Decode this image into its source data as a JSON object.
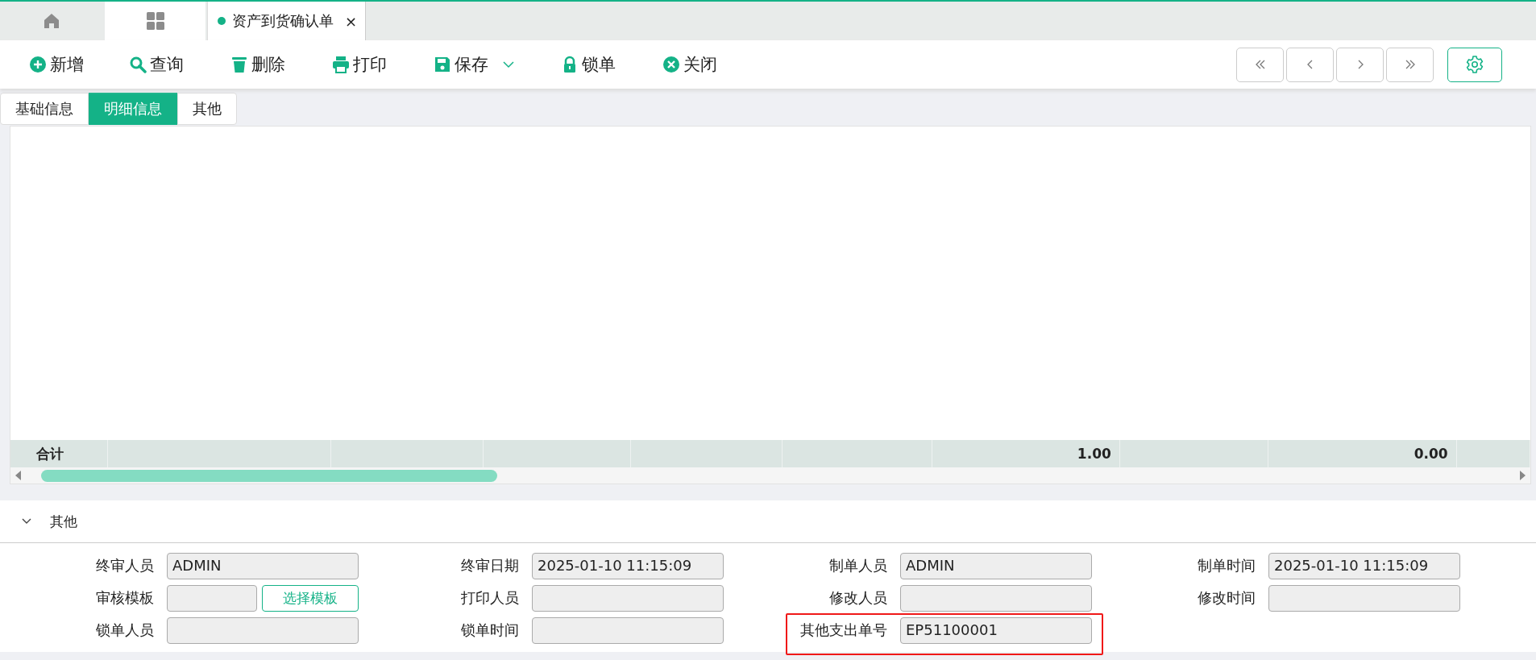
{
  "tabs": [
    {
      "kind": "home",
      "selected": false
    },
    {
      "kind": "grid",
      "selected": true
    },
    {
      "kind": "document",
      "label": "资产到货确认单",
      "close": "×",
      "selected": true
    }
  ],
  "toolbar": [
    {
      "kind": "add",
      "label": "新增"
    },
    {
      "kind": "search",
      "label": "查询"
    },
    {
      "kind": "delete",
      "label": "删除"
    },
    {
      "kind": "print",
      "label": "打印"
    },
    {
      "kind": "save",
      "label": "保存",
      "dropdown": true
    },
    {
      "kind": "lock",
      "label": "锁单"
    },
    {
      "kind": "close",
      "label": "关闭"
    }
  ],
  "nav_buttons": [
    {
      "kind": "first"
    },
    {
      "kind": "prev"
    },
    {
      "kind": "next"
    },
    {
      "kind": "last"
    }
  ],
  "sub_tabs": [
    {
      "label": "基础信息",
      "selected": false
    },
    {
      "label": "明细信息",
      "selected": true
    },
    {
      "label": "其他",
      "selected": false
    }
  ],
  "table": {
    "total_row": {
      "label": "合计",
      "cells": [
        null,
        null,
        null,
        null,
        null,
        "1.00",
        null,
        "0.00",
        null
      ]
    }
  },
  "section": {
    "title": "其他",
    "expanded": true
  },
  "fields": [
    {
      "label": "终审人员",
      "value": "ADMIN"
    },
    {
      "label": "终审日期",
      "value": "2025-01-10 11:15:09"
    },
    {
      "label": "制单人员",
      "value": "ADMIN"
    },
    {
      "label": "制单时间",
      "value": "2025-01-10 11:15:09"
    },
    {
      "label": "审核模板",
      "kind": "template",
      "button": "选择模板"
    },
    {
      "label": "打印人员"
    },
    {
      "label": "修改人员"
    },
    {
      "label": "修改时间"
    },
    {
      "label": "锁单人员"
    },
    {
      "label": "锁单时间"
    },
    {
      "label": "其他支出单号",
      "value": "EP51100001",
      "highlighted": true
    }
  ]
}
